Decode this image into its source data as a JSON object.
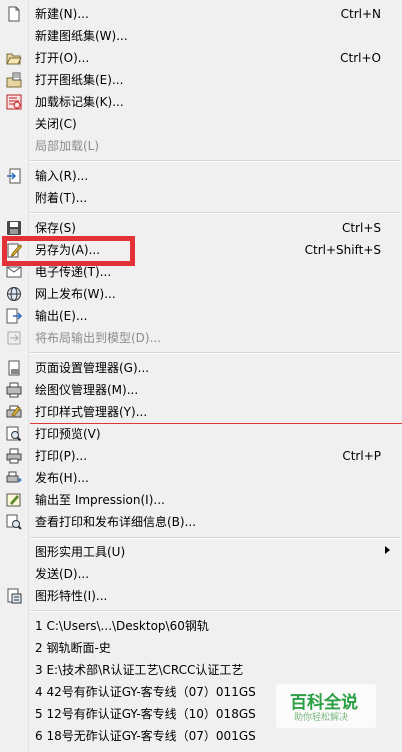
{
  "menu": {
    "items": [
      {
        "name": "new",
        "label": "新建(N)...",
        "shortcut": "Ctrl+N",
        "icon": "new-document-icon",
        "enabled": true
      },
      {
        "name": "new-sheet-set",
        "label": "新建图纸集(W)...",
        "shortcut": "",
        "icon": "",
        "enabled": true
      },
      {
        "name": "open",
        "label": "打开(O)...",
        "shortcut": "Ctrl+O",
        "icon": "open-folder-icon",
        "enabled": true
      },
      {
        "name": "open-sheet-set",
        "label": "打开图纸集(E)...",
        "shortcut": "",
        "icon": "sheet-set-icon",
        "enabled": true
      },
      {
        "name": "load-markup-set",
        "label": "加载标记集(K)...",
        "shortcut": "",
        "icon": "markup-set-icon",
        "enabled": true
      },
      {
        "name": "close",
        "label": "关闭(C)",
        "shortcut": "",
        "icon": "",
        "enabled": true
      },
      {
        "name": "partial-load",
        "label": "局部加载(L)",
        "shortcut": "",
        "icon": "",
        "enabled": false
      },
      {
        "name": "import",
        "label": "输入(R)...",
        "shortcut": "",
        "icon": "import-icon",
        "enabled": true
      },
      {
        "name": "attach",
        "label": "附着(T)...",
        "shortcut": "",
        "icon": "",
        "enabled": true
      },
      {
        "name": "save",
        "label": "保存(S)",
        "shortcut": "Ctrl+S",
        "icon": "floppy-disk-icon",
        "enabled": true
      },
      {
        "name": "save-as",
        "label": "另存为(A)...",
        "shortcut": "Ctrl+Shift+S",
        "icon": "pencil-page-icon",
        "enabled": true
      },
      {
        "name": "etransmit",
        "label": "电子传递(T)...",
        "shortcut": "",
        "icon": "etransmit-icon",
        "enabled": true
      },
      {
        "name": "publish-web",
        "label": "网上发布(W)...",
        "shortcut": "",
        "icon": "globe-icon",
        "enabled": true
      },
      {
        "name": "export",
        "label": "输出(E)...",
        "shortcut": "",
        "icon": "export-icon",
        "enabled": true
      },
      {
        "name": "export-layout",
        "label": "将布局输出到模型(D)...",
        "shortcut": "",
        "icon": "layout-to-model-icon",
        "enabled": false
      },
      {
        "name": "page-setup",
        "label": "页面设置管理器(G)...",
        "shortcut": "",
        "icon": "page-setup-icon",
        "enabled": true
      },
      {
        "name": "plotter-manager",
        "label": "绘图仪管理器(M)...",
        "shortcut": "",
        "icon": "plotter-icon",
        "enabled": true
      },
      {
        "name": "plot-style-manager",
        "label": "打印样式管理器(Y)...",
        "shortcut": "",
        "icon": "plot-style-icon",
        "enabled": true
      },
      {
        "name": "plot-preview",
        "label": "打印预览(V)",
        "shortcut": "",
        "icon": "preview-magnifier-icon",
        "enabled": true
      },
      {
        "name": "plot",
        "label": "打印(P)...",
        "shortcut": "Ctrl+P",
        "icon": "printer-icon",
        "enabled": true
      },
      {
        "name": "publish",
        "label": "发布(H)...",
        "shortcut": "",
        "icon": "publish-icon",
        "enabled": true
      },
      {
        "name": "export-impression",
        "label": "输出至 Impression(I)...",
        "shortcut": "",
        "icon": "impression-icon",
        "enabled": true
      },
      {
        "name": "plot-details",
        "label": "查看打印和发布详细信息(B)...",
        "shortcut": "",
        "icon": "plot-details-icon",
        "enabled": true
      },
      {
        "name": "drawing-utilities",
        "label": "图形实用工具(U)",
        "shortcut": "",
        "icon": "",
        "enabled": true,
        "submenu": true
      },
      {
        "name": "send",
        "label": "发送(D)...",
        "shortcut": "",
        "icon": "",
        "enabled": true
      },
      {
        "name": "drawing-properties",
        "label": "图形特性(I)...",
        "shortcut": "",
        "icon": "properties-icon",
        "enabled": true
      },
      {
        "name": "recent-1",
        "label": "1 C:\\Users\\...\\Desktop\\60钢轨",
        "shortcut": "",
        "icon": "",
        "enabled": true
      },
      {
        "name": "recent-2",
        "label": "2 钢轨断面-史",
        "shortcut": "",
        "icon": "",
        "enabled": true
      },
      {
        "name": "recent-3",
        "label": "3 E:\\技术部\\R认证工艺\\CRCC认证工艺",
        "shortcut": "",
        "icon": "",
        "enabled": true
      },
      {
        "name": "recent-4",
        "label": "4 42号有砟认证GY-客专线（07）011GS",
        "shortcut": "",
        "icon": "",
        "enabled": true
      },
      {
        "name": "recent-5",
        "label": "5 12号有砟认证GY-客专线（10）018GS",
        "shortcut": "",
        "icon": "",
        "enabled": true
      },
      {
        "name": "recent-6",
        "label": "6 18号无砟认证GY-客专线（07）001GS",
        "shortcut": "",
        "icon": "",
        "enabled": true
      }
    ]
  },
  "watermark": {
    "title": "百科全说",
    "subtitle": "助你轻松解决"
  },
  "colors": {
    "highlight": "#e23237",
    "divider_red": "#d9373a",
    "menu_bg": "#f0f0f0"
  }
}
